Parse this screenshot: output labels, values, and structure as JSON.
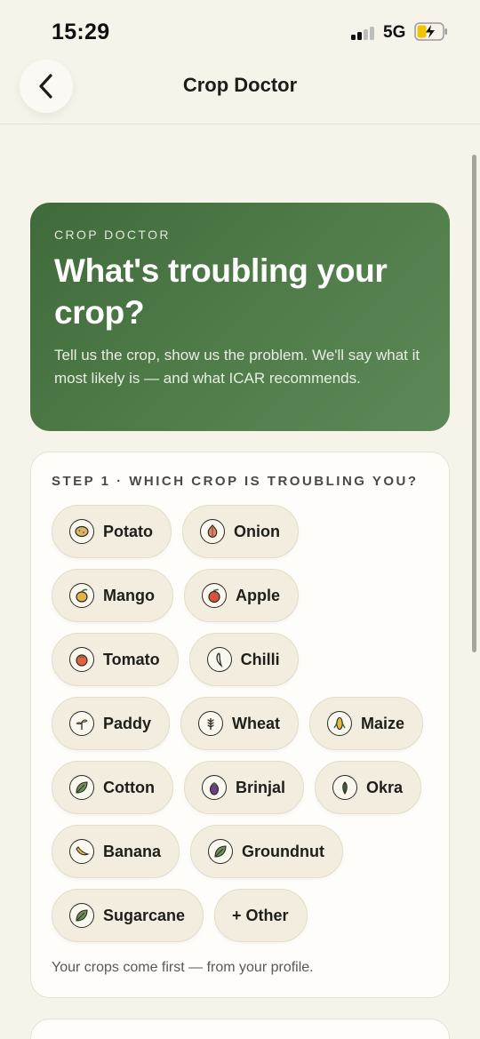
{
  "status": {
    "time": "15:29",
    "network": "5G"
  },
  "header": {
    "title": "Crop Doctor"
  },
  "hero": {
    "eyebrow": "CROP DOCTOR",
    "title": "What's troubling your crop?",
    "subtitle": "Tell us the crop, show us the problem. We'll say what it most likely is — and what ICAR recommends."
  },
  "step1": {
    "title": "STEP 1 · WHICH CROP IS TROUBLING YOU?",
    "crops": [
      {
        "label": "Potato",
        "icon": "potato-icon"
      },
      {
        "label": "Onion",
        "icon": "onion-icon"
      },
      {
        "label": "Mango",
        "icon": "mango-icon"
      },
      {
        "label": "Apple",
        "icon": "apple-icon"
      },
      {
        "label": "Tomato",
        "icon": "tomato-icon"
      },
      {
        "label": "Chilli",
        "icon": "chilli-icon"
      },
      {
        "label": "Paddy",
        "icon": "paddy-icon"
      },
      {
        "label": "Wheat",
        "icon": "wheat-icon"
      },
      {
        "label": "Maize",
        "icon": "maize-icon"
      },
      {
        "label": "Cotton",
        "icon": "leaf-icon"
      },
      {
        "label": "Brinjal",
        "icon": "brinjal-icon"
      },
      {
        "label": "Okra",
        "icon": "okra-icon"
      },
      {
        "label": "Banana",
        "icon": "banana-icon"
      },
      {
        "label": "Groundnut",
        "icon": "leaf-icon"
      },
      {
        "label": "Sugarcane",
        "icon": "leaf-icon"
      }
    ],
    "other_label": "+ Other",
    "footnote": "Your crops come first — from your profile."
  },
  "colors": {
    "hero": "#4e7a48",
    "background": "#f6f3ea",
    "chip": "#f2eddf"
  }
}
